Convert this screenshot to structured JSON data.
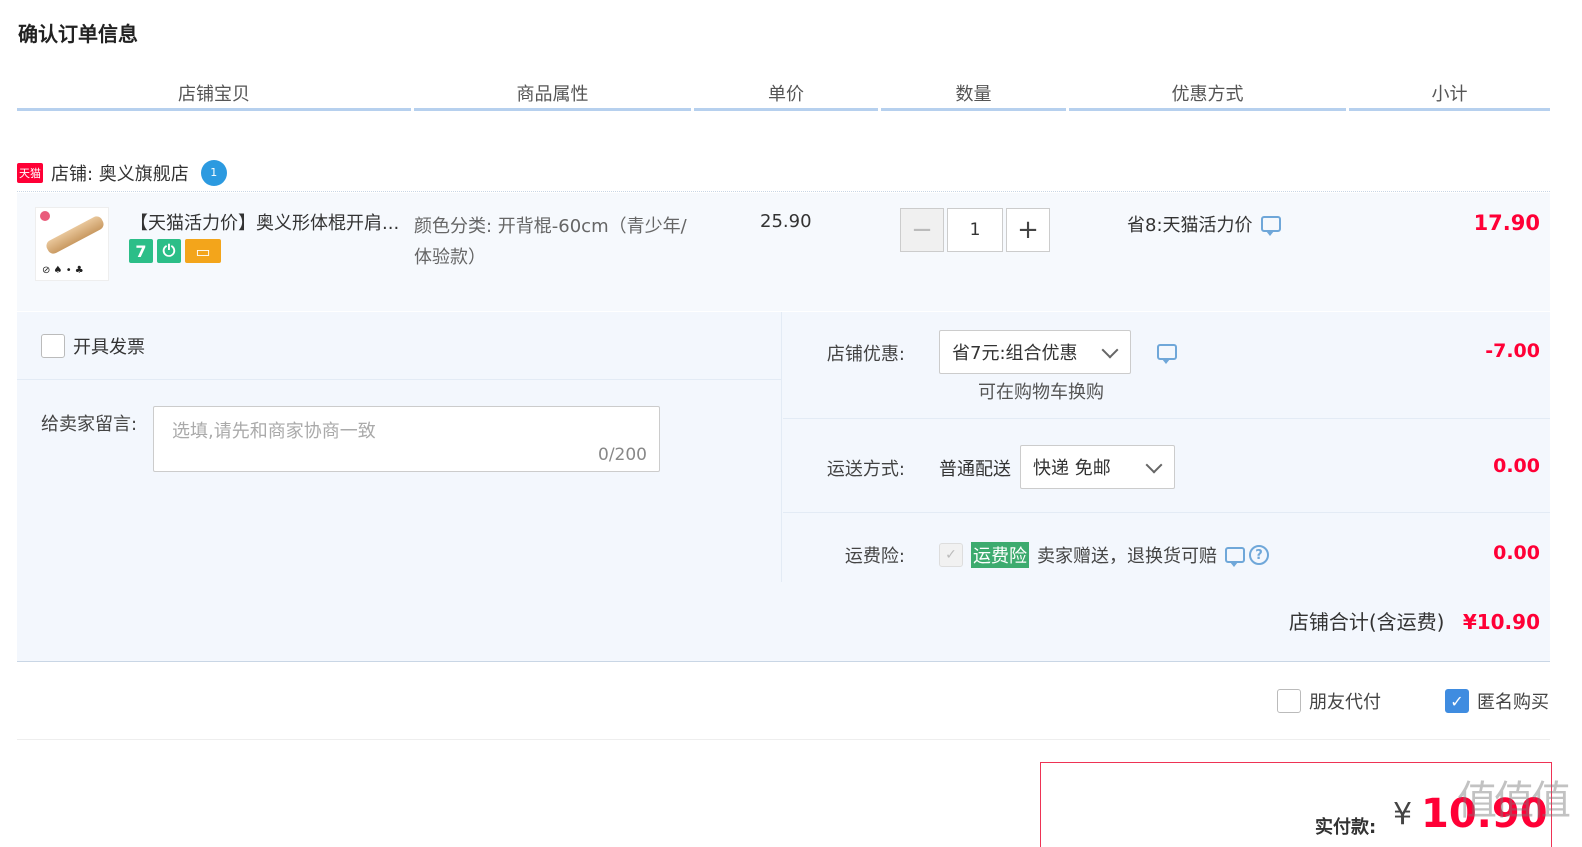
{
  "page": {
    "title": "确认订单信息"
  },
  "columns": [
    "店铺宝贝",
    "商品属性",
    "单价",
    "数量",
    "优惠方式",
    "小计"
  ],
  "shop": {
    "badge": "天猫",
    "label": "店铺: 奥义旗舰店",
    "wangwang": "1"
  },
  "item": {
    "title": "【天猫活力价】奥义形体棍开肩...",
    "service_icon_7": "7",
    "sku": "颜色分类: 开背棍-60cm（青少年/体验款）",
    "unit_price": "25.90",
    "quantity": "1",
    "promo": "省8:天猫活力价",
    "subtotal": "17.90"
  },
  "invoice": {
    "label": "开具发票"
  },
  "message": {
    "label": "给卖家留言:",
    "placeholder": "选填,请先和商家协商一致",
    "count": "0/200"
  },
  "discount": {
    "label": "店铺优惠:",
    "selected": "省7元:组合优惠",
    "note": "可在购物车换购",
    "amount": "-7.00"
  },
  "shipping": {
    "label": "运送方式:",
    "method": "普通配送",
    "selected": "快递 免邮",
    "amount": "0.00"
  },
  "insurance": {
    "label": "运费险:",
    "tag": "运费险",
    "text": "卖家赠送，退换货可赔",
    "amount": "0.00"
  },
  "shop_total": {
    "label": "店铺合计(含运费)",
    "amount": "¥10.90"
  },
  "options": {
    "friend_pay": "朋友代付",
    "anonymous": "匿名购买"
  },
  "payment": {
    "label": "实付款:",
    "currency": "¥",
    "amount": "10.90"
  },
  "watermark": "值值值"
}
